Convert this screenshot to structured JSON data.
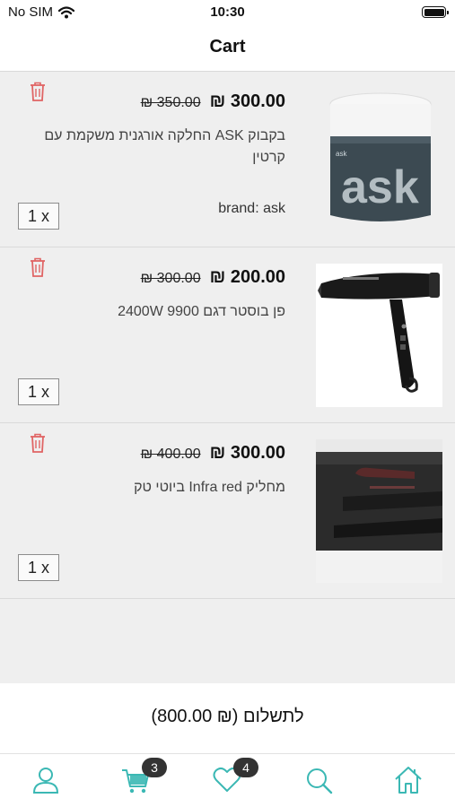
{
  "status_bar": {
    "carrier": "No SIM",
    "time": "10:30"
  },
  "nav": {
    "title": "Cart"
  },
  "items": [
    {
      "price_new": "₪ 300.00",
      "price_old": "₪ 350.00",
      "name": "בקבוק ASK החלקה אורגנית משקמת עם קרטין",
      "brand": "brand: ask",
      "qty": "1 x"
    },
    {
      "price_new": "₪ 200.00",
      "price_old": "₪ 300.00",
      "name": "פן בוסטר דגם 9900 2400W",
      "brand": "",
      "qty": "1 x"
    },
    {
      "price_new": "₪ 300.00",
      "price_old": "₪ 400.00",
      "name": "מחליק Infra red ביוטי טק",
      "brand": "",
      "qty": "1 x"
    }
  ],
  "total": {
    "label": "לתשלום (₪ 800.00)"
  },
  "tabbar": {
    "cart_badge": "3",
    "wishlist_badge": "4",
    "accent_color": "#3bb8b4"
  }
}
